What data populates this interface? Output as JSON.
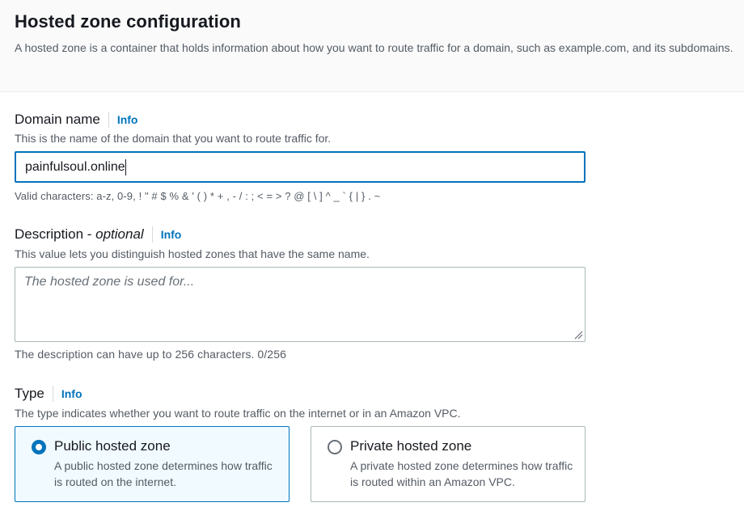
{
  "header": {
    "title": "Hosted zone configuration",
    "description": "A hosted zone is a container that holds information about how you want to route traffic for a domain, such as example.com, and its subdomains."
  },
  "domain": {
    "label": "Domain name",
    "info": "Info",
    "description": "This is the name of the domain that you want to route traffic for.",
    "value": "painfulsoul.online",
    "hint": "Valid characters: a-z, 0-9, ! \" # $ % & ' ( ) * + , - / : ; < = > ? @ [ \\ ] ^ _ ` { | } . ~"
  },
  "description_field": {
    "label": "Description - ",
    "label_optional": "optional",
    "info": "Info",
    "description": "This value lets you distinguish hosted zones that have the same name.",
    "placeholder": "The hosted zone is used for...",
    "hint": "The description can have up to 256 characters. 0/256"
  },
  "type": {
    "label": "Type",
    "info": "Info",
    "description": "The type indicates whether you want to route traffic on the internet or in an Amazon VPC.",
    "options": [
      {
        "title": "Public hosted zone",
        "description": "A public hosted zone determines how traffic is routed on the internet.",
        "selected": true
      },
      {
        "title": "Private hosted zone",
        "description": "A private hosted zone determines how traffic is routed within an Amazon VPC.",
        "selected": false
      }
    ]
  },
  "colors": {
    "accent": "#0073bb",
    "selected_bg": "#f1faff",
    "border": "#aab7b8",
    "muted_text": "#545b64"
  }
}
